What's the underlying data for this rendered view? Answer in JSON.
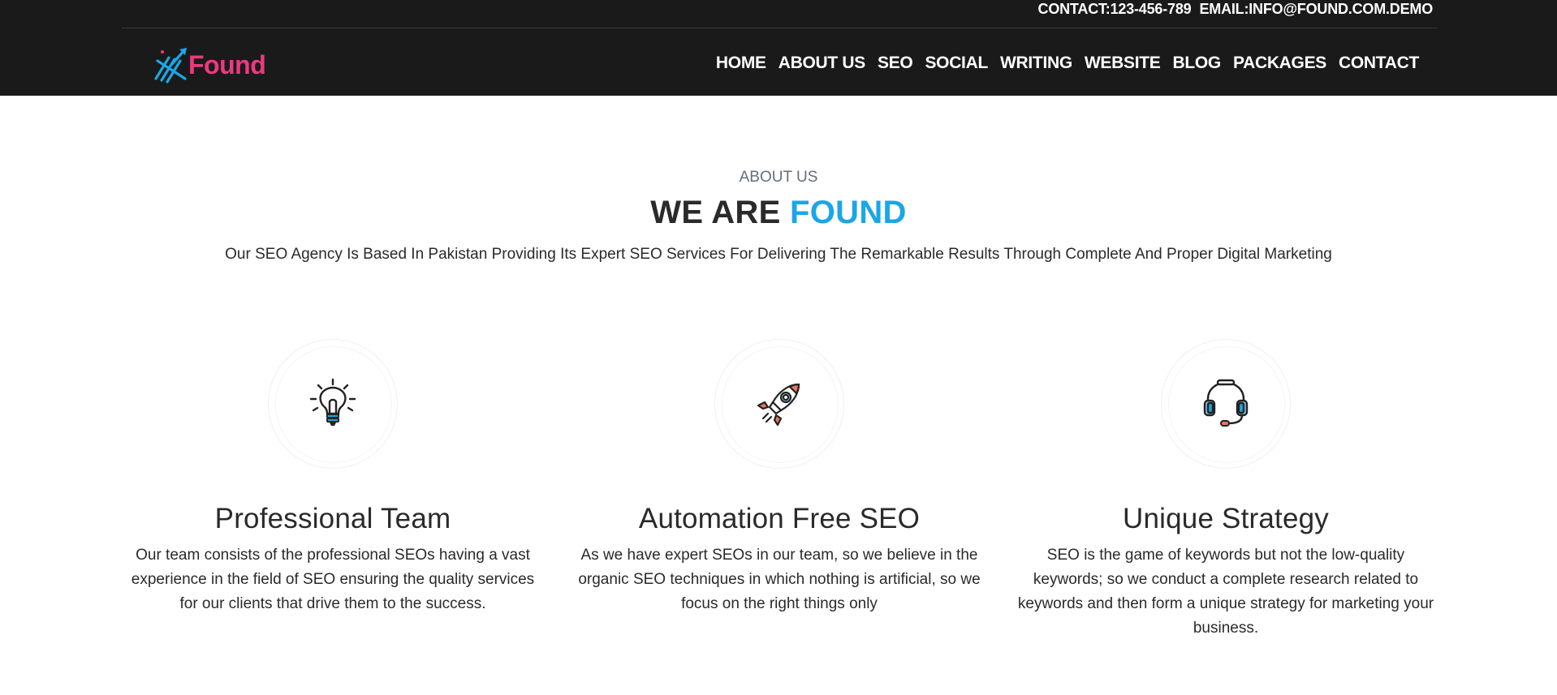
{
  "topbar": {
    "contact": "CONTACT:123-456-789",
    "email": "EMAIL:INFO@FOUND.COM.DEMO"
  },
  "logo": {
    "text": "Found",
    "text_color": "#ec3a80",
    "mark_color": "#1ba6e6"
  },
  "nav": {
    "items": [
      "HOME",
      "ABOUT US",
      "SEO",
      "SOCIAL",
      "WRITING",
      "WEBSITE",
      "BLOG",
      "PACKAGES",
      "CONTACT"
    ]
  },
  "about": {
    "eyebrow": "ABOUT US",
    "title_plain": "WE ARE",
    "title_accent": "FOUND",
    "subtitle": "Our SEO Agency Is Based In Pakistan Providing Its Expert SEO Services For Delivering The Remarkable Results Through Complete And Proper Digital Marketing"
  },
  "features": [
    {
      "icon": "lightbulb-icon",
      "title": "Professional Team",
      "description": "Our team consists of the professional SEOs having a vast experience in the field of SEO ensuring the quality services for our clients that drive them to the success."
    },
    {
      "icon": "rocket-icon",
      "title": "Automation Free SEO",
      "description": "As we have expert SEOs in our team, so we believe in the organic SEO techniques in which nothing is artificial, so we focus on the right things only"
    },
    {
      "icon": "headset-icon",
      "title": "Unique Strategy",
      "description": "SEO is the game of keywords but not the low-quality keywords; so we conduct a complete research related to keywords and then form a unique strategy for marketing your business."
    }
  ],
  "colors": {
    "header_bg": "#1a1a1a",
    "accent_blue": "#1ba6e6",
    "accent_pink": "#ec3a80",
    "text_dark": "#2a2a2a"
  }
}
